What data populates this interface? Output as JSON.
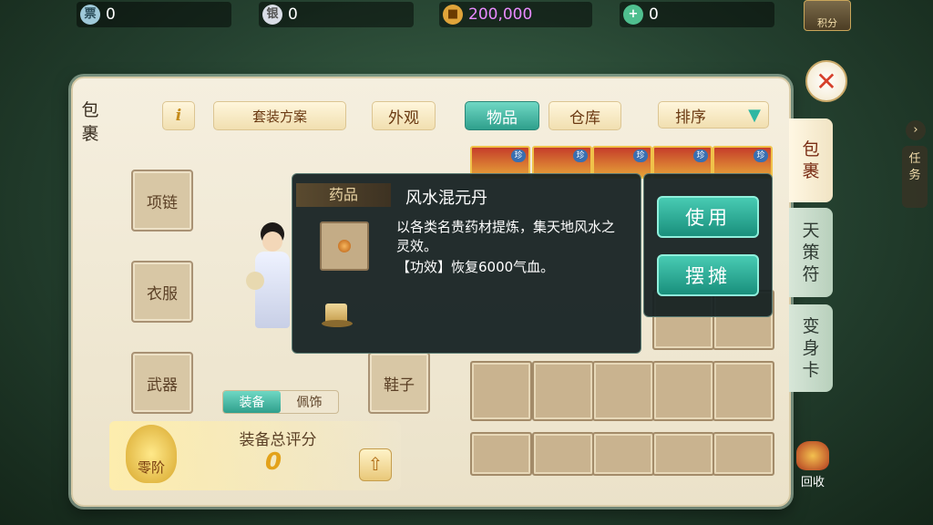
{
  "currencies": [
    {
      "icon": "silver-ticket-icon",
      "value": "0",
      "color": "#ffffff"
    },
    {
      "icon": "silver-ingot-icon",
      "value": "0",
      "color": "#ffffff"
    },
    {
      "icon": "gold-coin-icon",
      "value": "200,000",
      "color": "#e98bff"
    },
    {
      "icon": "jade-coin-icon",
      "value": "0",
      "color": "#ffffff"
    }
  ],
  "top_right": {
    "label": "积分"
  },
  "panel": {
    "left_tab": "包\n裹",
    "info_btn": "i",
    "suit_plan": "套装方案",
    "appearance": "外观",
    "tab_items": "物品",
    "tab_warehouse": "仓库",
    "sort": "排序"
  },
  "equip_slots": {
    "necklace": "项链",
    "clothes": "衣服",
    "weapon": "武器",
    "shoes": "鞋子"
  },
  "subtabs": {
    "equip": "装备",
    "accessory": "佩饰"
  },
  "score": {
    "title": "装备总评分",
    "value": "0",
    "rank": "零阶"
  },
  "item_badges": [
    "珍",
    "珍",
    "珍",
    "珍",
    "珍"
  ],
  "tooltip": {
    "category": "药品",
    "name": "风水混元丹",
    "desc": "以各类名贵药材提炼，集天地风水之灵效。",
    "effect": "【功效】恢复6000气血。"
  },
  "actions": {
    "use": "使用",
    "stall": "摆摊"
  },
  "right_tabs": {
    "bag": "包\n裹",
    "talisman": "天\n策\n符",
    "transform": "变\n身\n卡",
    "recycle": "回收"
  },
  "side": {
    "task": "任\n务"
  },
  "colors": {
    "accent": "#2f9f8c",
    "panel": "#f5efdf"
  }
}
